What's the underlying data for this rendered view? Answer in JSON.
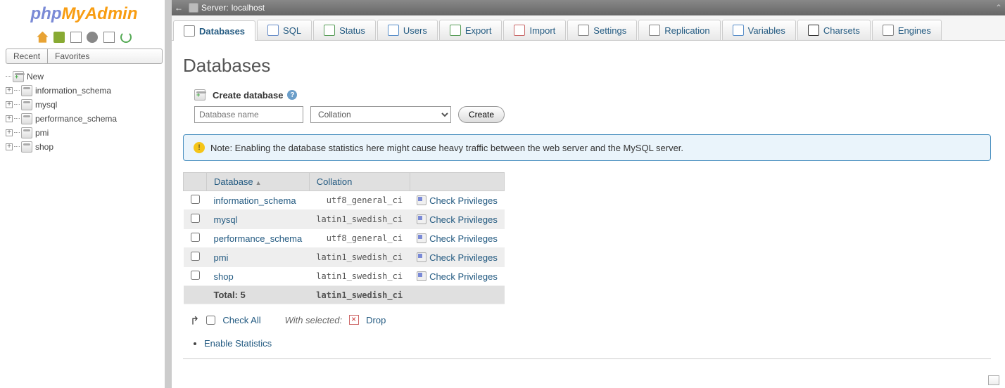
{
  "logo": {
    "php": "php",
    "my": "My",
    "admin": "Admin"
  },
  "sidebar_tabs": {
    "recent": "Recent",
    "favorites": "Favorites"
  },
  "tree": {
    "new_label": "New",
    "items": [
      "information_schema",
      "mysql",
      "performance_schema",
      "pmi",
      "shop"
    ]
  },
  "topbar": {
    "server_label": "Server:",
    "server_name": "localhost"
  },
  "tabs": [
    {
      "label": "Databases",
      "icon": "database-icon",
      "active": true
    },
    {
      "label": "SQL",
      "icon": "sql-icon"
    },
    {
      "label": "Status",
      "icon": "status-icon"
    },
    {
      "label": "Users",
      "icon": "users-icon"
    },
    {
      "label": "Export",
      "icon": "export-icon"
    },
    {
      "label": "Import",
      "icon": "import-icon"
    },
    {
      "label": "Settings",
      "icon": "settings-icon"
    },
    {
      "label": "Replication",
      "icon": "replication-icon"
    },
    {
      "label": "Variables",
      "icon": "variables-icon"
    },
    {
      "label": "Charsets",
      "icon": "charsets-icon"
    },
    {
      "label": "Engines",
      "icon": "engines-icon"
    }
  ],
  "page_title": "Databases",
  "create": {
    "header": "Create database",
    "placeholder": "Database name",
    "collation_placeholder": "Collation",
    "button": "Create"
  },
  "alert": "Note: Enabling the database statistics here might cause heavy traffic between the web server and the MySQL server.",
  "table": {
    "cols": {
      "database": "Database",
      "collation": "Collation"
    },
    "rows": [
      {
        "name": "information_schema",
        "collation": "utf8_general_ci",
        "action": "Check Privileges"
      },
      {
        "name": "mysql",
        "collation": "latin1_swedish_ci",
        "action": "Check Privileges"
      },
      {
        "name": "performance_schema",
        "collation": "utf8_general_ci",
        "action": "Check Privileges"
      },
      {
        "name": "pmi",
        "collation": "latin1_swedish_ci",
        "action": "Check Privileges"
      },
      {
        "name": "shop",
        "collation": "latin1_swedish_ci",
        "action": "Check Privileges"
      }
    ],
    "footer": {
      "total_label": "Total: 5",
      "collation": "latin1_swedish_ci"
    }
  },
  "check_all": {
    "label": "Check All",
    "with_selected": "With selected:",
    "drop": "Drop"
  },
  "enable_stats": "Enable Statistics"
}
